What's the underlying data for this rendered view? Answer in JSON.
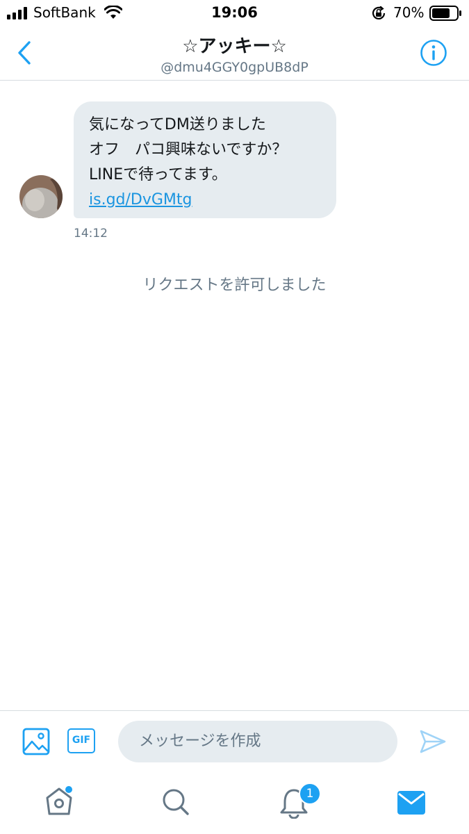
{
  "status_bar": {
    "carrier": "SoftBank",
    "time": "19:06",
    "battery": "70%"
  },
  "nav": {
    "title": "☆アッキー☆",
    "handle": "@dmu4GGY0gpUB8dP"
  },
  "message": {
    "lines": [
      "気になってDM送りました",
      "オフ　パコ興味ないですか？",
      "LINEで待ってます。"
    ],
    "link": "is.gd/DvGMtg",
    "time": "14:12"
  },
  "system_note": "リクエストを許可しました",
  "composer": {
    "placeholder": "メッセージを作成",
    "gif_label": "GIF"
  },
  "tabbar": {
    "notifications_badge": "1"
  },
  "colors": {
    "accent": "#1da1f2",
    "bubble": "#e6ecf0",
    "muted": "#657786"
  },
  "icons": [
    "back-chevron-icon",
    "info-icon",
    "image-icon",
    "gif-icon",
    "send-icon",
    "home-icon",
    "search-icon",
    "bell-icon",
    "mail-icon"
  ]
}
